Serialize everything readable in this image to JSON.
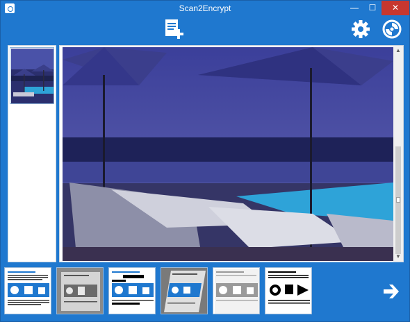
{
  "window": {
    "title": "Scan2Encrypt",
    "controls": {
      "minimize": "—",
      "maximize": "☐",
      "close": "✕"
    }
  },
  "toolbar": {
    "add_page_icon": "document-add-icon",
    "settings_icon": "gear-icon",
    "logo_icon": "scan2encrypt-logo-icon"
  },
  "sidebar": {
    "pages": [
      {
        "selected": true
      }
    ]
  },
  "preview": {
    "scrollbar": {
      "up": "▲",
      "down": "▼"
    }
  },
  "filters": {
    "items": [
      {
        "name": "original",
        "frame": "#ffffff"
      },
      {
        "name": "grayscale",
        "frame": "#808080"
      },
      {
        "name": "redacted",
        "frame": "#ffffff"
      },
      {
        "name": "skewed",
        "frame": "#808080"
      },
      {
        "name": "bright",
        "frame": "#e8e8e8"
      },
      {
        "name": "black-white",
        "frame": "#ffffff"
      }
    ]
  },
  "navigation": {
    "next_icon": "arrow-right-icon"
  },
  "colors": {
    "accent": "#1f78cf",
    "close": "#c7372f"
  }
}
